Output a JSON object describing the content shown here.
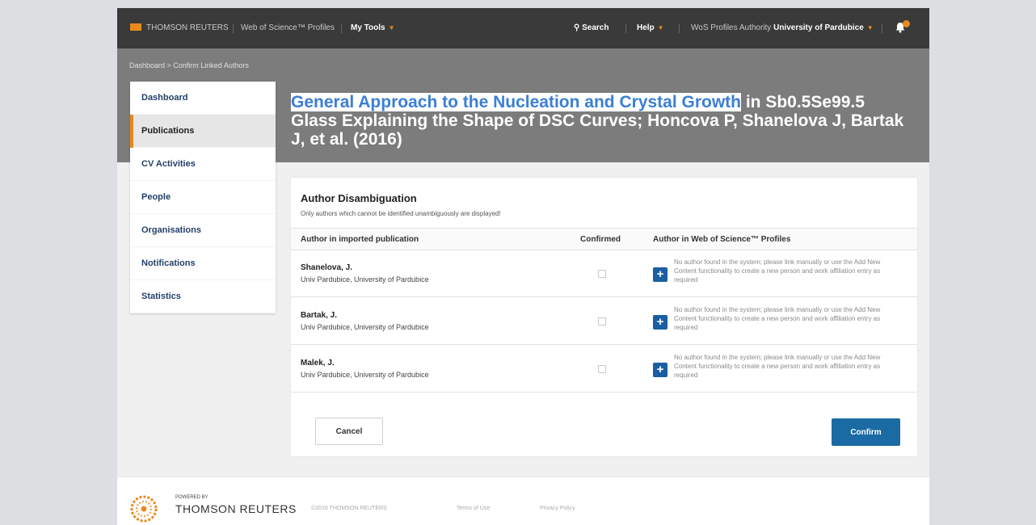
{
  "topbar": {
    "brand": "THOMSON REUTERS",
    "product": "Web of Science™ Profiles",
    "my_tools": "My Tools",
    "search": "Search",
    "help": "Help",
    "authority_label": "WoS Profiles Authority",
    "authority_value": "University of Pardubice"
  },
  "breadcrumb": "Dashboard > Confirm Linked Authors",
  "title": {
    "highlighted": "General Approach to the Nucleation and Crystal Growth",
    "rest": " in Sb0.5Se99.5 Glass Explaining the Shape of DSC Curves; Honcova P, Shanelova J, Bartak J, et al. (2016)"
  },
  "sidebar": {
    "items": [
      {
        "label": "Dashboard"
      },
      {
        "label": "Publications"
      },
      {
        "label": "CV Activities"
      },
      {
        "label": "People"
      },
      {
        "label": "Organisations"
      },
      {
        "label": "Notifications"
      },
      {
        "label": "Statistics"
      }
    ],
    "active_index": 1
  },
  "panel": {
    "title": "Author Disambiguation",
    "subtitle": "Only authors which cannot be identified unambiguously are displayed!",
    "columns": {
      "author": "Author in imported publication",
      "confirmed": "Confirmed",
      "profile": "Author in Web of Science™ Profiles"
    },
    "rows": [
      {
        "name": "Shanelova, J.",
        "affiliation": "Univ Pardubice, University of Pardubice",
        "message": "No author found in the system; please link manually or use the Add New Content functionality to create a new person and work affiliation entry as required"
      },
      {
        "name": "Bartak, J.",
        "affiliation": "Univ Pardubice, University of Pardubice",
        "message": "No author found in the system; please link manually or use the Add New Content functionality to create a new person and work affiliation entry as required"
      },
      {
        "name": "Malek, J.",
        "affiliation": "Univ Pardubice, University of Pardubice",
        "message": "No author found in the system; please link manually or use the Add New Content functionality to create a new person and work affiliation entry as required"
      }
    ],
    "cancel": "Cancel",
    "confirm": "Confirm"
  },
  "footer": {
    "powered": "POWERED BY",
    "brand": "THOMSON REUTERS",
    "copyright": "©2016 THOMSON REUTERS",
    "terms": "Terms of Use",
    "privacy": "Privacy Policy"
  },
  "colors": {
    "accent_orange": "#e8891c",
    "link_blue": "#24406a",
    "button_blue": "#1a6aa3"
  }
}
